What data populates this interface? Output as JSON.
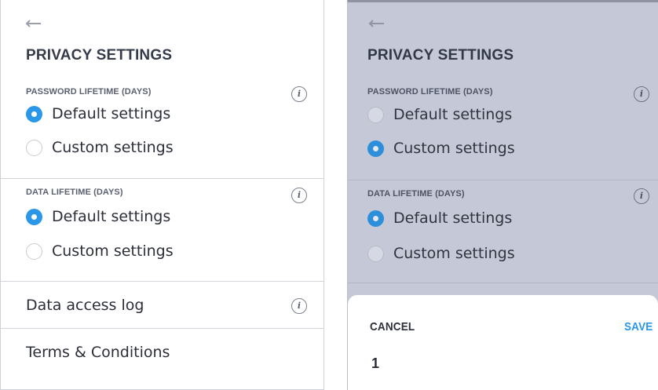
{
  "left": {
    "title": "PRIVACY SETTINGS",
    "password_lifetime": {
      "label": "PASSWORD LIFETIME (DAYS)",
      "options": [
        "Default settings",
        "Custom settings"
      ],
      "selected": "Default settings"
    },
    "data_lifetime": {
      "label": "DATA LIFETIME (DAYS)",
      "options": [
        "Default settings",
        "Custom settings"
      ],
      "selected": "Default settings"
    },
    "data_access_log": "Data access log",
    "terms": "Terms & Conditions"
  },
  "right": {
    "title": "PRIVACY SETTINGS",
    "password_lifetime": {
      "label": "PASSWORD LIFETIME (DAYS)",
      "options": [
        "Default settings",
        "Custom settings"
      ],
      "selected": "Custom settings"
    },
    "data_lifetime": {
      "label": "DATA LIFETIME (DAYS)",
      "options": [
        "Default settings",
        "Custom settings"
      ],
      "selected": "Default settings"
    },
    "sheet": {
      "cancel_label": "CANCEL",
      "save_label": "SAVE",
      "picker_value": "1"
    }
  },
  "icons": {
    "back": "back-arrow-icon",
    "info": "info-icon",
    "info_glyph": "i"
  },
  "colors": {
    "accent": "#2a97e8",
    "overlay": "#c5c9d7"
  }
}
